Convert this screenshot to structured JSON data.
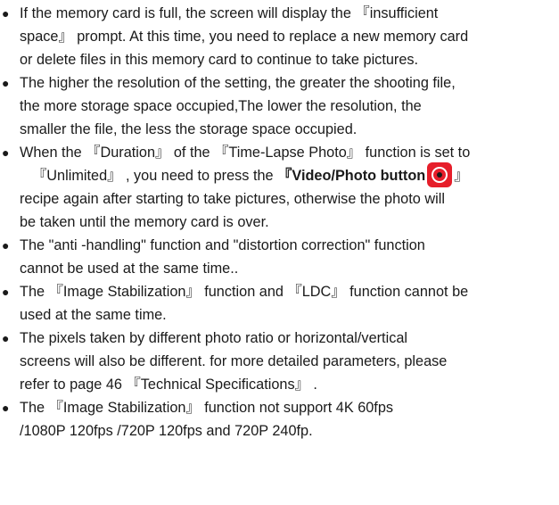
{
  "bullets": [
    {
      "lines": [
        "If the memory card is full, the screen will display the 『insufficient",
        "space』 prompt. At this time, you need to replace a new memory card",
        "or delete files in this memory card to continue to take pictures."
      ]
    },
    {
      "lines": [
        "The higher the resolution of the setting, the greater the shooting file,",
        "the more storage space occupied,The lower the resolution, the",
        "smaller the file, the less the storage space occupied."
      ]
    },
    {
      "line1": "When the 『Duration』 of the 『Time-Lapse Photo』 function is set to",
      "line2": "『Unlimited』 , you need to press the ",
      "line2_bold": "『Video/Photo button",
      "line2_end": "』",
      "line3": "recipe again after starting to take pictures, otherwise the photo will",
      "line4": "be taken until the memory card is over."
    },
    {
      "lines": [
        "The \"anti -handling\" function and \"distortion correction\" function",
        "cannot be used at the same time.."
      ]
    },
    {
      "lines": [
        "The 『Image Stabilization』  function and 『LDC』 function cannot be",
        "used at the same time."
      ]
    },
    {
      "lines": [
        "The pixels taken by different photo ratio or horizontal/vertical",
        "screens will also be different. for more detailed parameters, please",
        "refer to page 46 『Technical Specifications』 ."
      ]
    },
    {
      "lines": [
        "The 『Image Stabilization』 function not support 4K 60fps",
        "/1080P 120fps /720P 120fps and 720P 240fp."
      ]
    }
  ],
  "bullet_symbol": "●",
  "icons": {
    "record_button": "record-button-icon"
  },
  "colors": {
    "record_red": "#e61e2a",
    "text": "#1a1a1a"
  }
}
